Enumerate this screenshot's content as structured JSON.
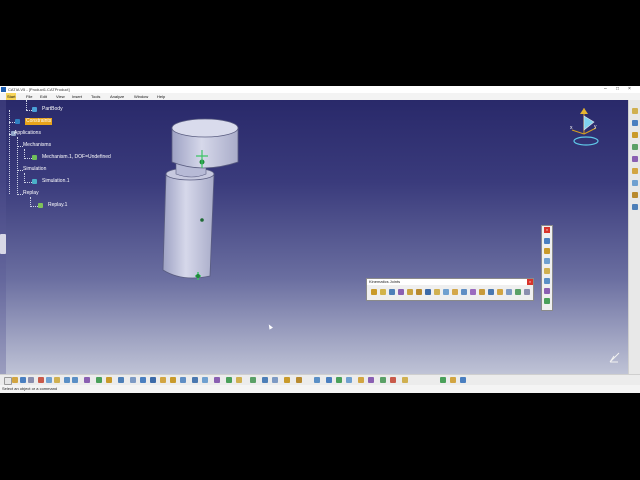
{
  "window": {
    "title": "CATIA V5 - [Product1.CATProduct]",
    "controls": [
      "–",
      "□",
      "×"
    ]
  },
  "menubar": {
    "items": [
      "Start",
      "File",
      "Edit",
      "View",
      "Insert",
      "Tools",
      "Analyze",
      "Window",
      "Help"
    ],
    "active": "Start"
  },
  "tree": {
    "partbody": "PartBody",
    "constraints": "Constraints",
    "applications": "Applications",
    "mechanisms": "Mechanisms",
    "mechanism1": "Mechanism.1, DOF=Undefined",
    "simulation": "Simulation",
    "simulation1": "Simulation.1",
    "replay": "Replay",
    "replay1": "Replay.1"
  },
  "kinematics_toolbar": {
    "title": "Kinematics Joints",
    "close": "×"
  },
  "small_toolbar": {
    "close": "×"
  },
  "status": {
    "text": "Select an object or a command"
  },
  "colors": {
    "accent_highlight": "#e8a31b",
    "background_top": "#29296a",
    "background_bottom": "#bfc3d6",
    "part": "#c8cbe0"
  }
}
